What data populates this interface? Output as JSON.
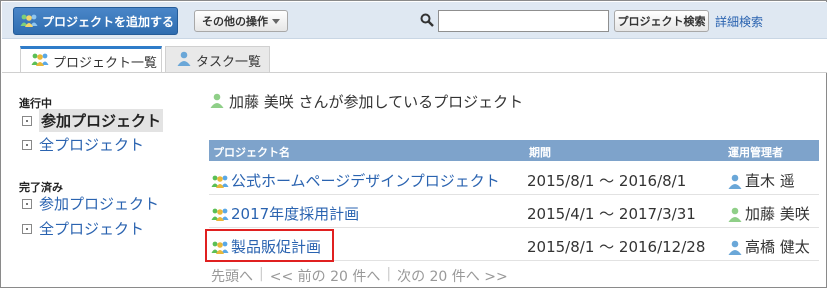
{
  "toolbar": {
    "add_project_label": "プロジェクトを追加する",
    "other_actions_label": "その他の操作",
    "search_placeholder": "",
    "search_button_label": "プロジェクト検索",
    "advanced_search_label": "詳細検索"
  },
  "tabs": [
    {
      "label": "プロジェクト一覧",
      "icon": "project-group-icon",
      "active": true
    },
    {
      "label": "タスク一覧",
      "icon": "user-icon",
      "active": false
    }
  ],
  "sidebar": {
    "in_progress_heading": "進行中",
    "in_progress_items": [
      {
        "label": "参加プロジェクト",
        "current": true
      },
      {
        "label": "全プロジェクト",
        "current": false
      }
    ],
    "completed_heading": "完了済み",
    "completed_items": [
      {
        "label": "参加プロジェクト",
        "current": false
      },
      {
        "label": "全プロジェクト",
        "current": false
      }
    ]
  },
  "main": {
    "title": "加藤 美咲 さんが参加しているプロジェクト",
    "columns": [
      "プロジェクト名",
      "期間",
      "運用管理者"
    ],
    "rows": [
      {
        "name": "公式ホームページデザインプロジェクト",
        "period": "2015/8/1 ～ 2016/8/1",
        "manager": "直木 遥"
      },
      {
        "name": "2017年度採用計画",
        "period": "2015/4/1 ～ 2017/3/31",
        "manager": "加藤 美咲"
      },
      {
        "name": "製品販促計画",
        "period": "2015/8/1 ～ 2016/12/28",
        "manager": "高橋 健太"
      }
    ],
    "pager": {
      "first": "先頭へ",
      "prev": "<< 前の 20 件へ",
      "next": "次の 20 件へ >>"
    }
  },
  "colors": {
    "accent": "#2f7cc9",
    "link": "#2a63b0",
    "table_header": "#7ea3cb",
    "highlight": "#e02020"
  }
}
